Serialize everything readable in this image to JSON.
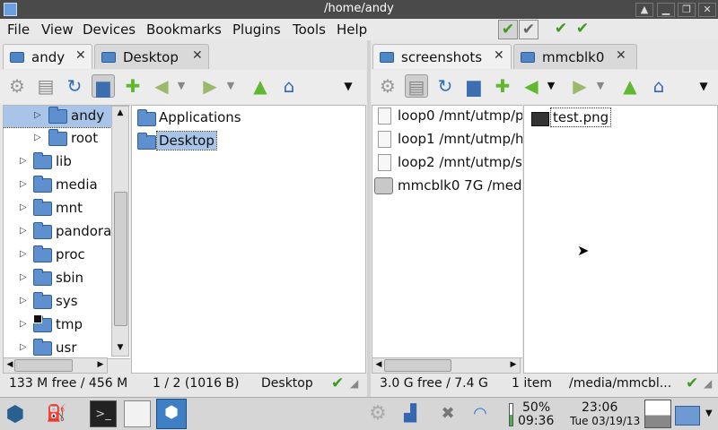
{
  "window": {
    "title": "/home/andy"
  },
  "menu": {
    "items": [
      "File",
      "View",
      "Devices",
      "Bookmarks",
      "Plugins",
      "Tools",
      "Help"
    ]
  },
  "left": {
    "tabs": [
      {
        "label": "andy"
      },
      {
        "label": "Desktop"
      }
    ],
    "tree": [
      {
        "label": "andy"
      },
      {
        "label": "root"
      },
      {
        "label": "lib"
      },
      {
        "label": "media"
      },
      {
        "label": "mnt"
      },
      {
        "label": "pandora"
      },
      {
        "label": "proc"
      },
      {
        "label": "sbin"
      },
      {
        "label": "sys"
      },
      {
        "label": "tmp"
      },
      {
        "label": "usr"
      }
    ],
    "files": [
      {
        "label": "Applications"
      },
      {
        "label": "Desktop"
      }
    ],
    "status": {
      "free": "133 M free / 456 M",
      "count": "1 / 2 (1016 B)",
      "location": "Desktop"
    }
  },
  "right": {
    "tabs": [
      {
        "label": "screenshots"
      },
      {
        "label": "mmcblk0"
      }
    ],
    "devices": [
      {
        "label": "loop0 /mnt/utmp/p"
      },
      {
        "label": "loop1 /mnt/utmp/h"
      },
      {
        "label": "loop2 /mnt/utmp/s"
      },
      {
        "label": "mmcblk0 7G /med"
      }
    ],
    "files": [
      {
        "label": "test.png"
      }
    ],
    "status": {
      "free": "3.0 G free / 7.4 G",
      "count": "1 item",
      "location": "/media/mmcbl..."
    }
  },
  "taskbar": {
    "battery": "50%",
    "battery_time": "09:36",
    "clock_time": "23:06",
    "clock_date": "Tue 03/19/13"
  },
  "colors": {
    "titlebar": "#4a4a4a",
    "folder": "#5e8fcf",
    "selection": "#a8c4e8",
    "check": "#3d9a1f"
  }
}
